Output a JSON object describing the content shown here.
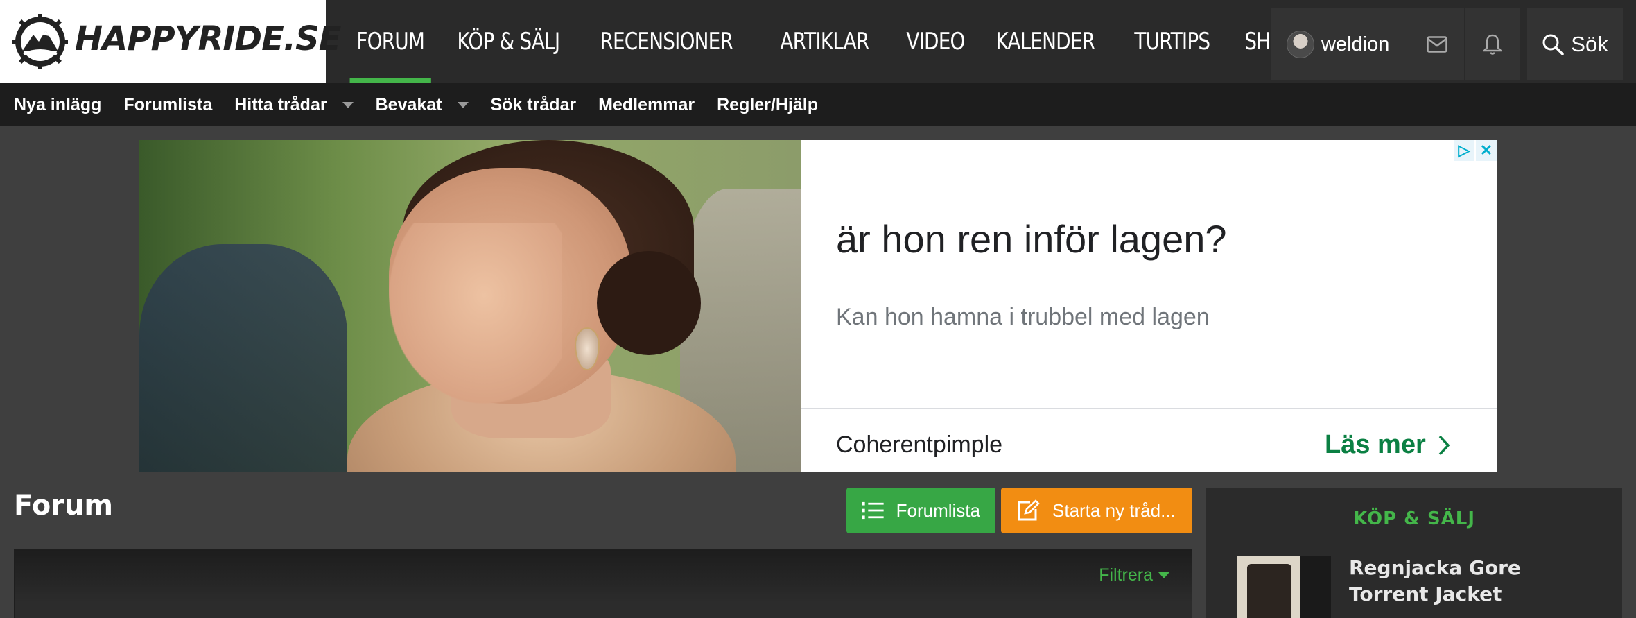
{
  "header": {
    "logo_text": "HAPPYRIDE.SE",
    "nav": [
      {
        "label": "FORUM",
        "active": true
      },
      {
        "label": "KÖP & SÄLJ"
      },
      {
        "label": "RECENSIONER"
      },
      {
        "label": "ARTIKLAR"
      },
      {
        "label": "VIDEO"
      },
      {
        "label": "KALENDER"
      },
      {
        "label": "TURTIPS"
      },
      {
        "label": "SHOP"
      }
    ],
    "username": "weldion",
    "search_label": "Sök",
    "accent_color": "#44b64a"
  },
  "subnav": [
    {
      "label": "Nya inlägg"
    },
    {
      "label": "Forumlista"
    },
    {
      "label": "Hitta trådar",
      "dropdown": true
    },
    {
      "label": "Bevakat",
      "dropdown": true
    },
    {
      "label": "Sök trådar"
    },
    {
      "label": "Medlemmar"
    },
    {
      "label": "Regler/Hjälp"
    }
  ],
  "ad": {
    "headline": "är hon ren inför lagen?",
    "subtext": "Kan hon hamna i trubbel med lagen",
    "advertiser": "Coherentpimple",
    "cta": "Läs mer",
    "badge_info": "▷",
    "badge_close": "✕"
  },
  "main": {
    "title": "Forum",
    "btn_forumlist": "Forumlista",
    "btn_new_thread": "Starta ny tråd...",
    "filter_label": "Filtrera"
  },
  "sidebar": {
    "section_title": "KÖP & SÄLJ",
    "item_title": "Regnjacka Gore Torrent Jacket"
  }
}
